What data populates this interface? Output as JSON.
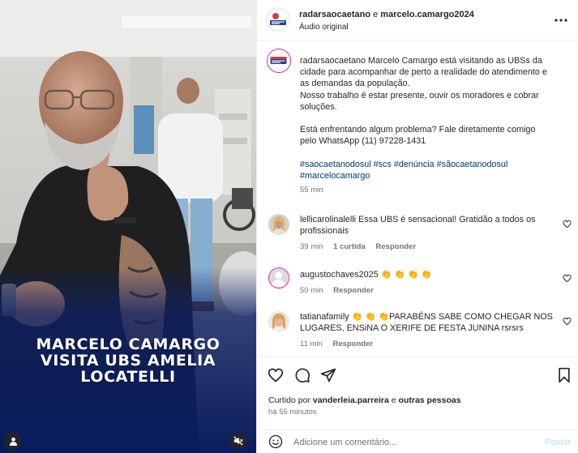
{
  "media": {
    "overlay_title": [
      "MARCELO CAMARGO",
      "VISITA UBS AMELIA",
      "LOCATELLI"
    ]
  },
  "header": {
    "author": "radarsaocaetano",
    "connector": "e",
    "collaborator": "marcelo.camargo2024",
    "audio": "Áudio original"
  },
  "caption": {
    "username": "radarsaocaetano",
    "lines": [
      "Marcelo Camargo está visitando as UBSs da",
      "cidade para acompanhar de perto a realidade do atendimento e",
      "as demandas da população.",
      "Nosso trabalho é estar presente, ouvir os moradores e cobrar",
      "soluções."
    ],
    "lines2": [
      "Está enfrentando algum problema? Fale diretamente comigo",
      "pelo WhatsApp (11) 97228-1431"
    ],
    "hashtags_line1": "#saocaetanodosul #scs #denúncia #sãocaetanodosul",
    "hashtags_line2": "#marcelocamargo",
    "time": "55 min"
  },
  "comments": [
    {
      "username": "lellicarolinalelli",
      "text_line1": "Essa UBS é sensacional! Gratidão a todos os",
      "text_line2": "profissionais",
      "time": "39 min",
      "likes": "1 curtida",
      "reply": "Responder"
    },
    {
      "username": "augustochaves2025",
      "text": "👏 👏 👏 👏",
      "time": "50 min",
      "reply": "Responder"
    },
    {
      "username": "tatianafamily",
      "text_line1": "👏 👏 👏PARABÉNS SABE COMO CHEGAR NOS",
      "text_line2": "LUGARES, ENSiNA O XERIFE DE FESTA JUNINA rsrsrs",
      "time": "11 min",
      "reply": "Responder"
    }
  ],
  "actions": {
    "liked_prefix": "Curtido por",
    "liked_by": "vanderleia.parreira",
    "liked_suffix": "e",
    "liked_others": "outras pessoas",
    "time": "há 55 minutos"
  },
  "add_comment": {
    "placeholder": "Adicione um comentário...",
    "post_label": "Postar"
  },
  "colors": {
    "link_blue": "#00376b",
    "post_disabled": "#b2dffc",
    "media_banner": "#0c2066"
  }
}
